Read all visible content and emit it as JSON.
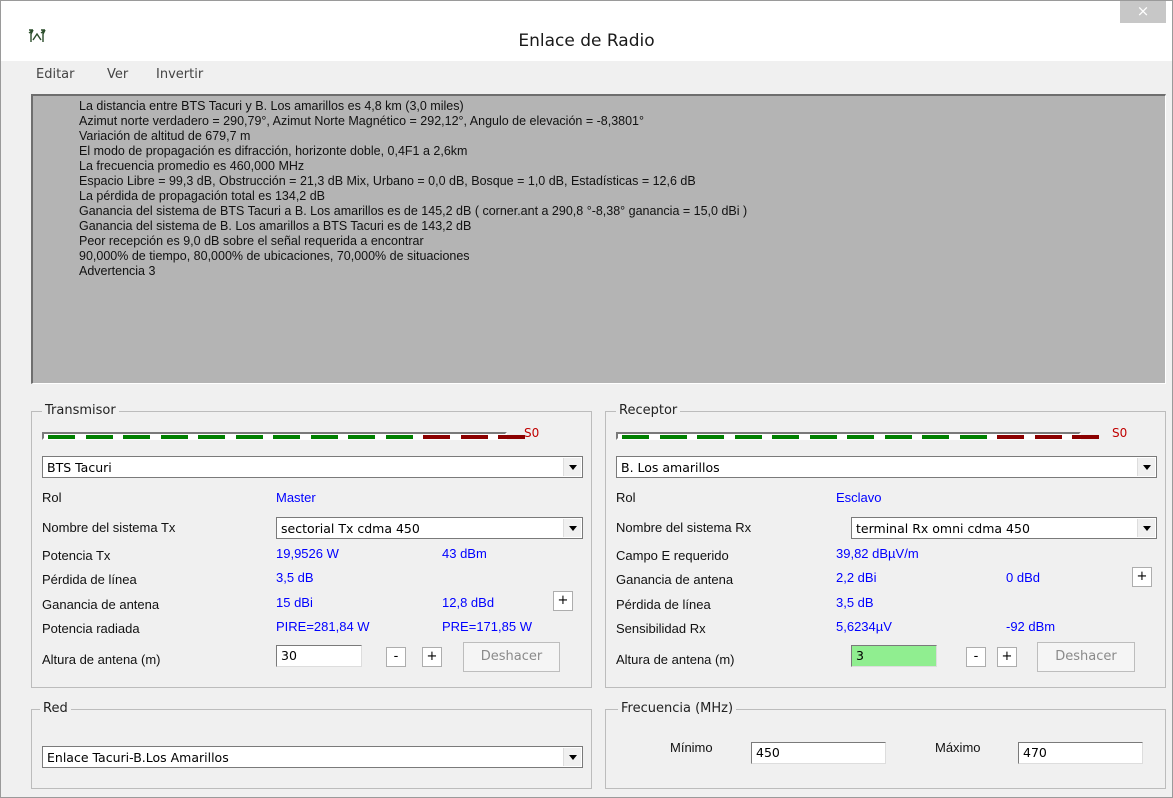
{
  "window": {
    "title": "Enlace de Radio",
    "close": "×"
  },
  "menu": [
    "Editar",
    "Ver",
    "Invertir"
  ],
  "info_lines": [
    "La distancia entre BTS Tacuri y B. Los amarillos es 4,8 km (3,0 miles)",
    "Azimut norte verdadero = 290,79°, Azimut Norte Magnético = 292,12°, Angulo de elevación = -8,3801°",
    "Variación de altitud de 679,7 m",
    "El modo de propagación es difracción, horizonte doble, 0,4F1 a 2,6km",
    "La frecuencia promedio es 460,000 MHz",
    "Espacio Libre = 99,3 dB, Obstrucción = 21,3 dB Mix, Urbano = 0,0 dB, Bosque = 1,0 dB, Estadísticas = 12,6 dB",
    "La pérdida de propagación total es 134,2 dB",
    "Ganancia del sistema de BTS Tacuri a B. Los amarillos es de 145,2 dB ( corner.ant a 290,8 °-8,38° ganancia = 15,0 dBi )",
    "Ganancia del sistema de B. Los amarillos a BTS Tacuri es de 143,2 dB",
    "Peor recepción es 9,0 dB sobre el señal requerida a encontrar",
    "90,000% de tiempo, 80,000% de ubicaciones, 70,000% de situaciones",
    "Advertencia 3"
  ],
  "transmisor": {
    "legend": "Transmisor",
    "meter_label": "S0",
    "meter_green_segments": 10,
    "meter_red_segments": 3,
    "station": "BTS Tacuri",
    "rol_label": "Rol",
    "rol_value": "Master",
    "sistema_label": "Nombre del sistema Tx",
    "sistema_value": "sectorial Tx cdma 450",
    "potencia_label": "Potencia Tx",
    "potencia_w": "19,9526 W",
    "potencia_dbm": "43 dBm",
    "perdida_label": "Pérdida de línea",
    "perdida_value": "3,5 dB",
    "ganancia_label": "Ganancia de antena",
    "ganancia_dbi": "15 dBi",
    "ganancia_dbd": "12,8 dBd",
    "radiada_label": "Potencia radiada",
    "pire": "PIRE=281,84 W",
    "pre": "PRE=171,85 W",
    "altura_label": "Altura de antena (m)",
    "altura_value": "30",
    "minus": "-",
    "plus": "+",
    "deshacer": "Deshacer"
  },
  "receptor": {
    "legend": "Receptor",
    "meter_label": "S0",
    "meter_green_segments": 10,
    "meter_red_segments": 3,
    "station": "B. Los amarillos",
    "rol_label": "Rol",
    "rol_value": "Esclavo",
    "sistema_label": "Nombre del sistema Rx",
    "sistema_value": "terminal Rx omni cdma 450",
    "campo_label": "Campo E requerido",
    "campo_value": "39,82 dBµV/m",
    "ganancia_label": "Ganancia de antena",
    "ganancia_dbi": "2,2 dBi",
    "ganancia_dbd": "0 dBd",
    "perdida_label": "Pérdida de línea",
    "perdida_value": "3,5 dB",
    "sens_label": "Sensibilidad Rx",
    "sens_uv": "5,6234µV",
    "sens_dbm": "-92 dBm",
    "altura_label": "Altura de antena (m)",
    "altura_value": "3",
    "minus": "-",
    "plus": "+",
    "deshacer": "Deshacer"
  },
  "red": {
    "legend": "Red",
    "value": "Enlace  Tacuri-B.Los Amarillos"
  },
  "frecuencia": {
    "legend": "Frecuencia (MHz)",
    "min_label": "Mínimo",
    "min_value": "450",
    "max_label": "Máximo",
    "max_value": "470"
  },
  "colors": {
    "green": "#008000",
    "red": "#8b0000",
    "value_blue": "#0000ff",
    "highlight": "#90ee90"
  }
}
